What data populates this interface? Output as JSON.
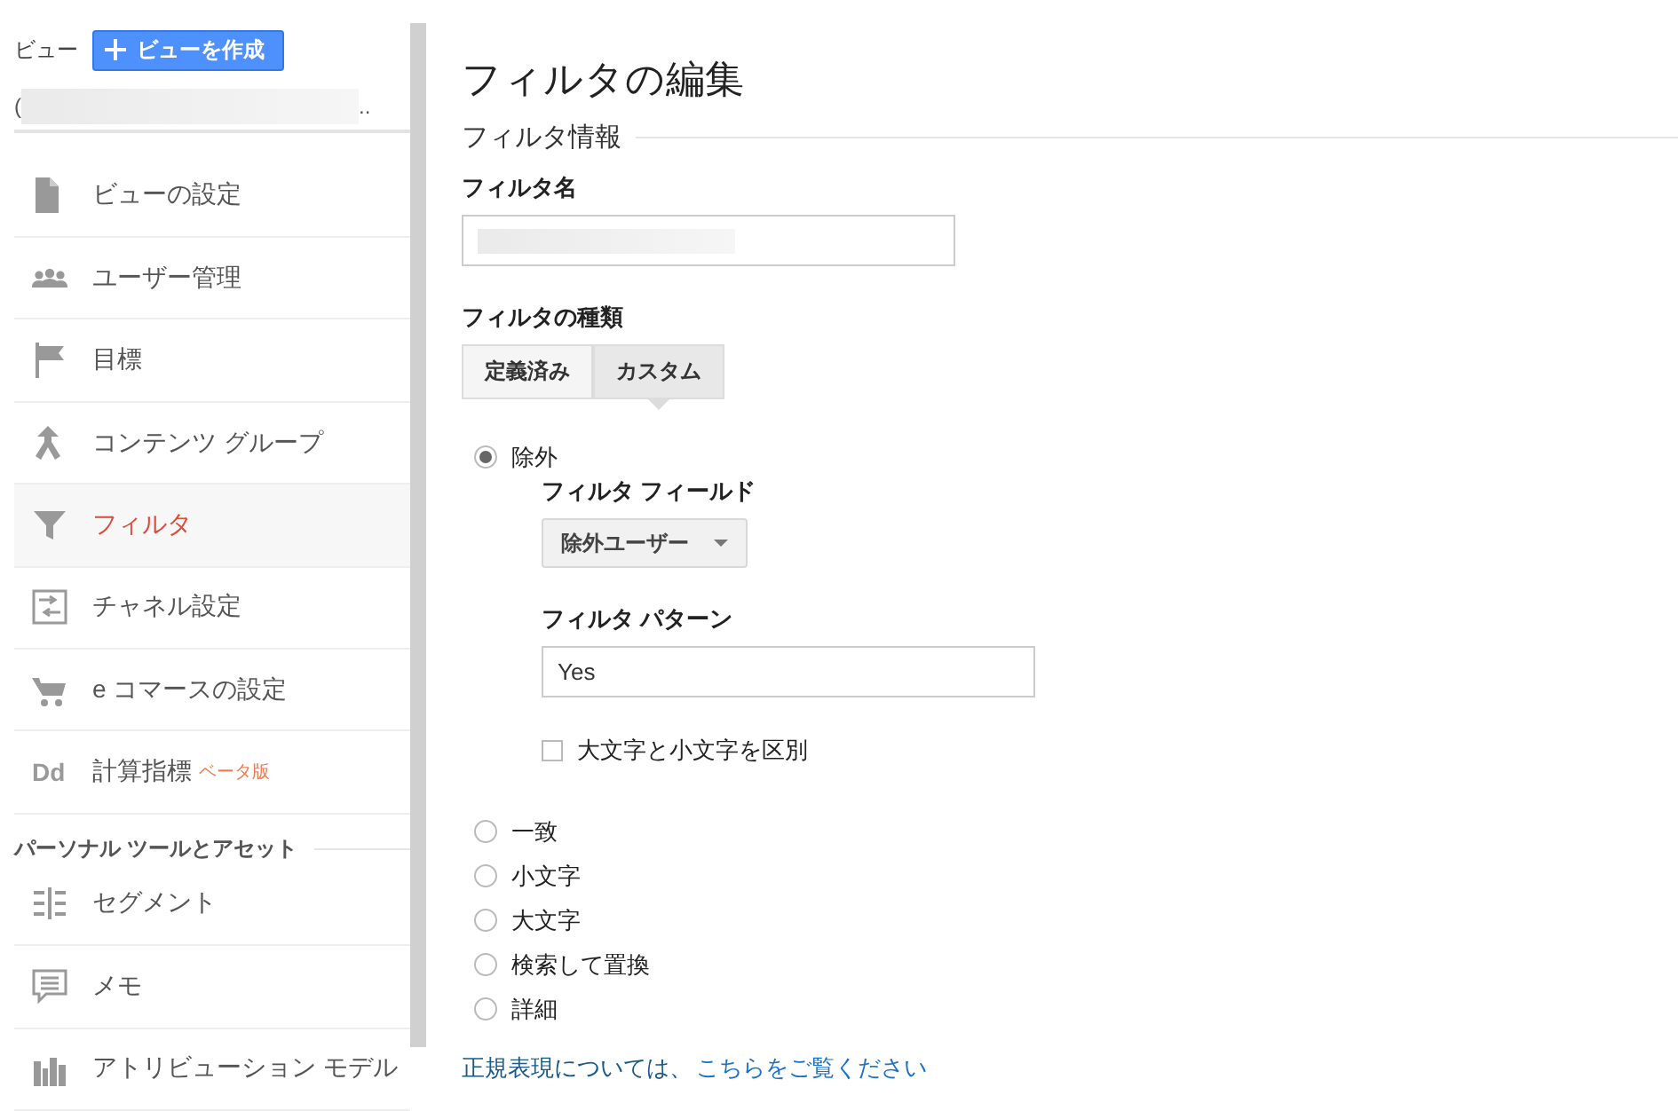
{
  "sidebar": {
    "view_label": "ビュー",
    "create_button": "ビューを作成",
    "account": {
      "prefix": "(",
      "suffix": ".."
    },
    "items": [
      {
        "label": "ビューの設定",
        "selected": false
      },
      {
        "label": "ユーザー管理",
        "selected": false
      },
      {
        "label": "目標",
        "selected": false
      },
      {
        "label": "コンテンツ グループ",
        "selected": false
      },
      {
        "label": "フィルタ",
        "selected": true
      },
      {
        "label": "チャネル設定",
        "selected": false
      },
      {
        "label": "e コマースの設定",
        "selected": false
      },
      {
        "label": "計算指標",
        "selected": false,
        "badge": "ベータ版",
        "icon_text": "Dd"
      }
    ],
    "section_title": "パーソナル ツールとアセット",
    "section_items": [
      {
        "label": "セグメント",
        "selected": false
      },
      {
        "label": "メモ",
        "selected": false
      },
      {
        "label": "アトリビューション モデル",
        "selected": false
      }
    ]
  },
  "page": {
    "title": "フィルタの編集",
    "section": "フィルタ情報",
    "name_label": "フィルタ名",
    "type_label": "フィルタの種類",
    "tabs": [
      {
        "label": "定義済み",
        "selected": false
      },
      {
        "label": "カスタム",
        "selected": true
      }
    ],
    "options": [
      {
        "label": "除外",
        "selected": true,
        "settings": {
          "field_label": "フィルタ フィールド",
          "field_value": "除外ユーザー",
          "pattern_label": "フィルタ パターン",
          "pattern_value": "Yes",
          "checkbox": {
            "label": "大文字と小文字を区別",
            "checked": false
          }
        }
      },
      {
        "label": "一致",
        "selected": false
      },
      {
        "label": "小文字",
        "selected": false
      },
      {
        "label": "大文字",
        "selected": false
      },
      {
        "label": "検索して置換",
        "selected": false
      },
      {
        "label": "詳細",
        "selected": false
      }
    ],
    "help_text": "正規表現については、",
    "help_link": "こちらをご覧ください"
  }
}
